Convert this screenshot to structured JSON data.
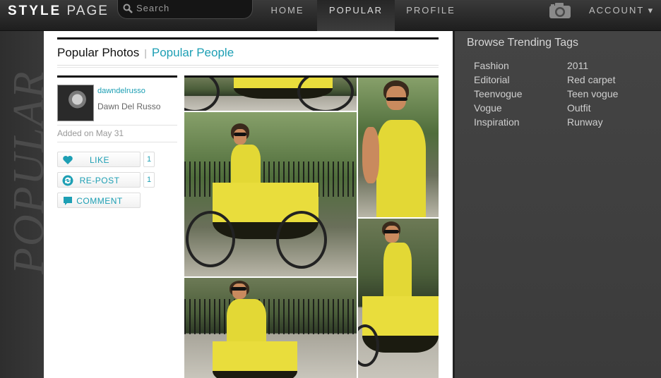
{
  "header": {
    "logo_bold": "STYLE",
    "logo_light": "PAGE",
    "search_placeholder": "Search",
    "nav": [
      "HOME",
      "POPULAR",
      "PROFILE"
    ],
    "account": "ACCOUNT ▾",
    "icons": [
      "search-icon",
      "camera-icon"
    ]
  },
  "side_label": "POPULAR",
  "main": {
    "tabs": {
      "active": "Popular Photos",
      "separator": "|",
      "other": "Popular People"
    },
    "post": {
      "username": "dawndelrusso",
      "fullname": "Dawn Del Russo",
      "added": "Added on May 31"
    },
    "actions": [
      {
        "label": "LIKE",
        "count": "1",
        "icon": "heart-icon"
      },
      {
        "label": "RE-POST",
        "count": "1",
        "icon": "repost-icon"
      },
      {
        "label": "COMMENT",
        "icon": "comment-icon"
      }
    ]
  },
  "trending": {
    "title": "Browse Trending Tags",
    "col1": [
      "Fashion",
      "Editorial",
      "Teenvogue",
      "Vogue",
      "Inspiration"
    ],
    "col2": [
      "2011",
      "Red carpet",
      "Teen vogue",
      "Outfit",
      "Runway"
    ]
  },
  "colors": {
    "accent": "#1d9fb4",
    "topbar": "#2a2a2a",
    "panel": "#404040"
  }
}
